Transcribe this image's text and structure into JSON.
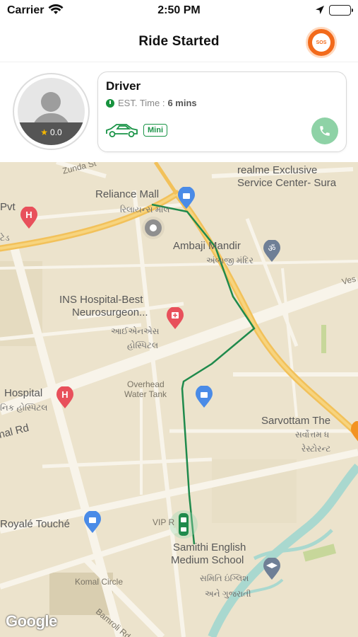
{
  "status_bar": {
    "carrier": "Carrier",
    "time": "2:50 PM"
  },
  "nav": {
    "title": "Ride Started",
    "sos_label": "SOS"
  },
  "driver": {
    "name": "Driver",
    "rating": "0.0",
    "eta_label": "EST. Time :",
    "eta_value": "6 mins",
    "vehicle_class": "Mini"
  },
  "map": {
    "labels": {
      "zunda": "Zunda St",
      "realme_1": "realme Exclusive",
      "realme_2": "Service Center- Sura",
      "reliance_en": "Reliance Mall",
      "reliance_gu": "રિલાયન્સ મૉલ",
      "pvt": "Pvt",
      "pvt_gu": "ટેડ",
      "ambaji_en": "Ambaji Mandir",
      "ambaji_gu": "અંબાજી મંદિર",
      "ves": "Ves",
      "ins_1": "INS Hospital-Best",
      "ins_2": "Neurosurgeon...",
      "ins_gu_1": "આઈએનએસ",
      "ins_gu_2": "હોસ્પિટલ",
      "overhead_1": "Overhead",
      "overhead_2": "Water Tank",
      "hospital_en": "Hospital",
      "hospital_gu": "નિક હોસ્પિટલ",
      "nal_rd": "nal Rd",
      "sarvottam_en": "Sarvottam The",
      "sarvottam_gu_1": "સર્વોત્તમ ધ",
      "sarvottam_gu_2": "રેસ્ટોરન્ટ",
      "royale": "Royalé Touché",
      "vip": "VIP R",
      "samithi_1": "Samithi English",
      "samithi_2": "Medium School",
      "samithi_gu_1": "સમિતિ ઇંગ્લિશ",
      "samithi_gu_2": "અને ગુજરાતી",
      "komal": "Komal Circle",
      "bamroli": "Bamroli Rd",
      "google": "Google"
    }
  },
  "colors": {
    "accent_green": "#1a9447",
    "sos_orange": "#f26a1b",
    "route_green": "#1f8a4c",
    "road_major": "#f2c15a",
    "map_bg": "#ece3cc"
  },
  "icons": {
    "wifi": "wifi-icon",
    "location": "location-arrow-icon",
    "sos": "sos-phone-icon",
    "clock": "clock-icon",
    "car": "car-outline-icon",
    "call": "phone-icon"
  }
}
